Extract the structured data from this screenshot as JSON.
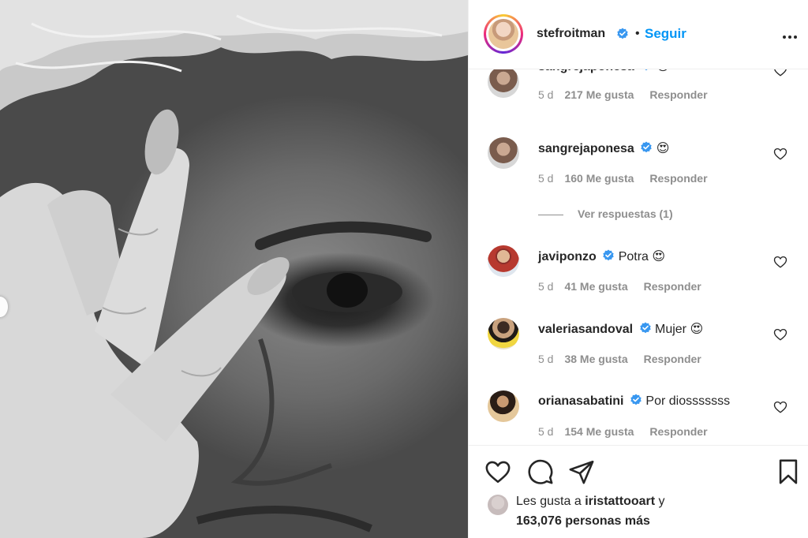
{
  "post": {
    "author": "stefroitman",
    "separator": "•",
    "follow_label": "Seguir"
  },
  "comments": [
    {
      "user": "sangrejaponesa",
      "text": "😍",
      "age": "5 d",
      "likes": "217 Me gusta",
      "reply": "Responder"
    },
    {
      "user": "sangrejaponesa",
      "text": "😍",
      "age": "5 d",
      "likes": "160 Me gusta",
      "reply": "Responder"
    },
    {
      "user": "javiponzo",
      "text": "Potra 😍",
      "age": "5 d",
      "likes": "41 Me gusta",
      "reply": "Responder"
    },
    {
      "user": "valeriasandoval",
      "text": "Mujer 😍",
      "age": "5 d",
      "likes": "38 Me gusta",
      "reply": "Responder"
    },
    {
      "user": "orianasabatini",
      "text": "Por diosssssss",
      "age": "5 d",
      "likes": "154 Me gusta",
      "reply": "Responder"
    }
  ],
  "view_replies": "Ver respuestas (1)",
  "likes_summary": {
    "prefix": "Les gusta a",
    "user": "iristattooart",
    "suffix": "y",
    "count_line": "163,076 personas más"
  },
  "icons": {
    "verified": "verified-badge-icon",
    "more": "more-options-icon",
    "like": "heart-icon",
    "comment": "comment-icon",
    "share": "paper-plane-icon",
    "save": "bookmark-icon"
  },
  "colors": {
    "accent": "#0095f6",
    "text": "#262626",
    "secondary": "#8e8e8e",
    "border": "#efefef"
  }
}
